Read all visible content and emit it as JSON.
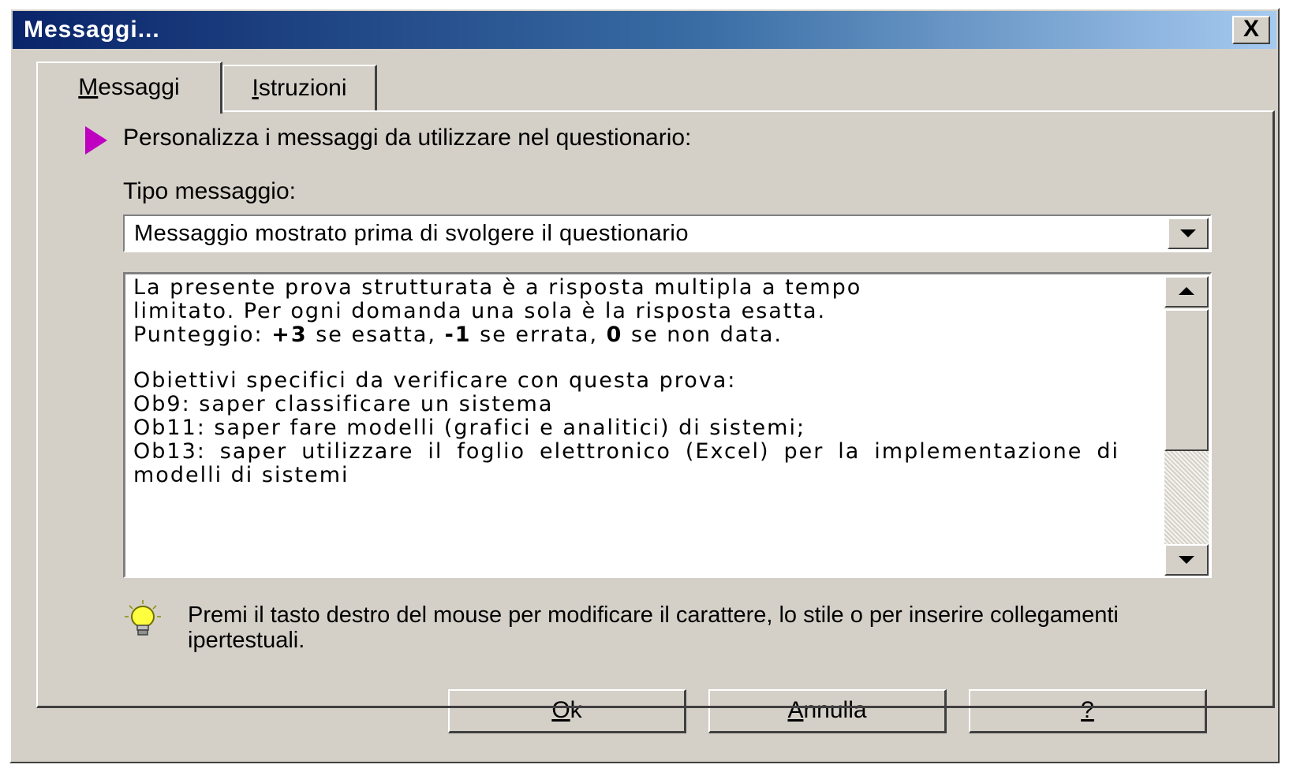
{
  "window": {
    "title": "Messaggi...",
    "close_label": "X"
  },
  "tabs": [
    {
      "accel": "M",
      "rest": "essaggi",
      "active": true
    },
    {
      "accel": "I",
      "rest": "struzioni",
      "active": false
    }
  ],
  "content": {
    "intro": "Personalizza i messaggi da utilizzare nel questionario:",
    "tipo_label": "Tipo messaggio:",
    "tipo_value": "Messaggio mostrato prima di svolgere il questionario",
    "memo": {
      "line1": "La presente prova strutturata è a risposta multipla a tempo",
      "line2": "limitato. Per ogni domanda una sola è la risposta esatta.",
      "line3_a": "Punteggio: ",
      "line3_b": "+3",
      "line3_c": " se esatta, ",
      "line3_d": "-1",
      "line3_e": " se errata, ",
      "line3_f": "0",
      "line3_g": " se non data.",
      "line4": "Obiettivi specifici da verificare con questa prova:",
      "line5": "Ob9: saper classificare un sistema",
      "line6": "Ob11: saper fare modelli (grafici e analitici) di sistemi;",
      "line7": "Ob13: saper utilizzare il foglio elettronico (Excel) per la implementazione di modelli di sistemi"
    },
    "hint": "Premi il tasto destro del mouse per modificare il carattere, lo stile o per inserire collegamenti ipertestuali."
  },
  "buttons": {
    "ok": {
      "accel": "O",
      "rest": "k"
    },
    "annulla": {
      "accel": "A",
      "rest": "nnulla"
    },
    "help": {
      "accel": "?",
      "rest": ""
    }
  },
  "colors": {
    "arrow": "#c000c0",
    "bulb": "#ffff40"
  },
  "icons": {
    "arrow": "pointer-arrow-icon",
    "bulb": "lightbulb-icon",
    "dropdown": "chevron-down-icon"
  }
}
